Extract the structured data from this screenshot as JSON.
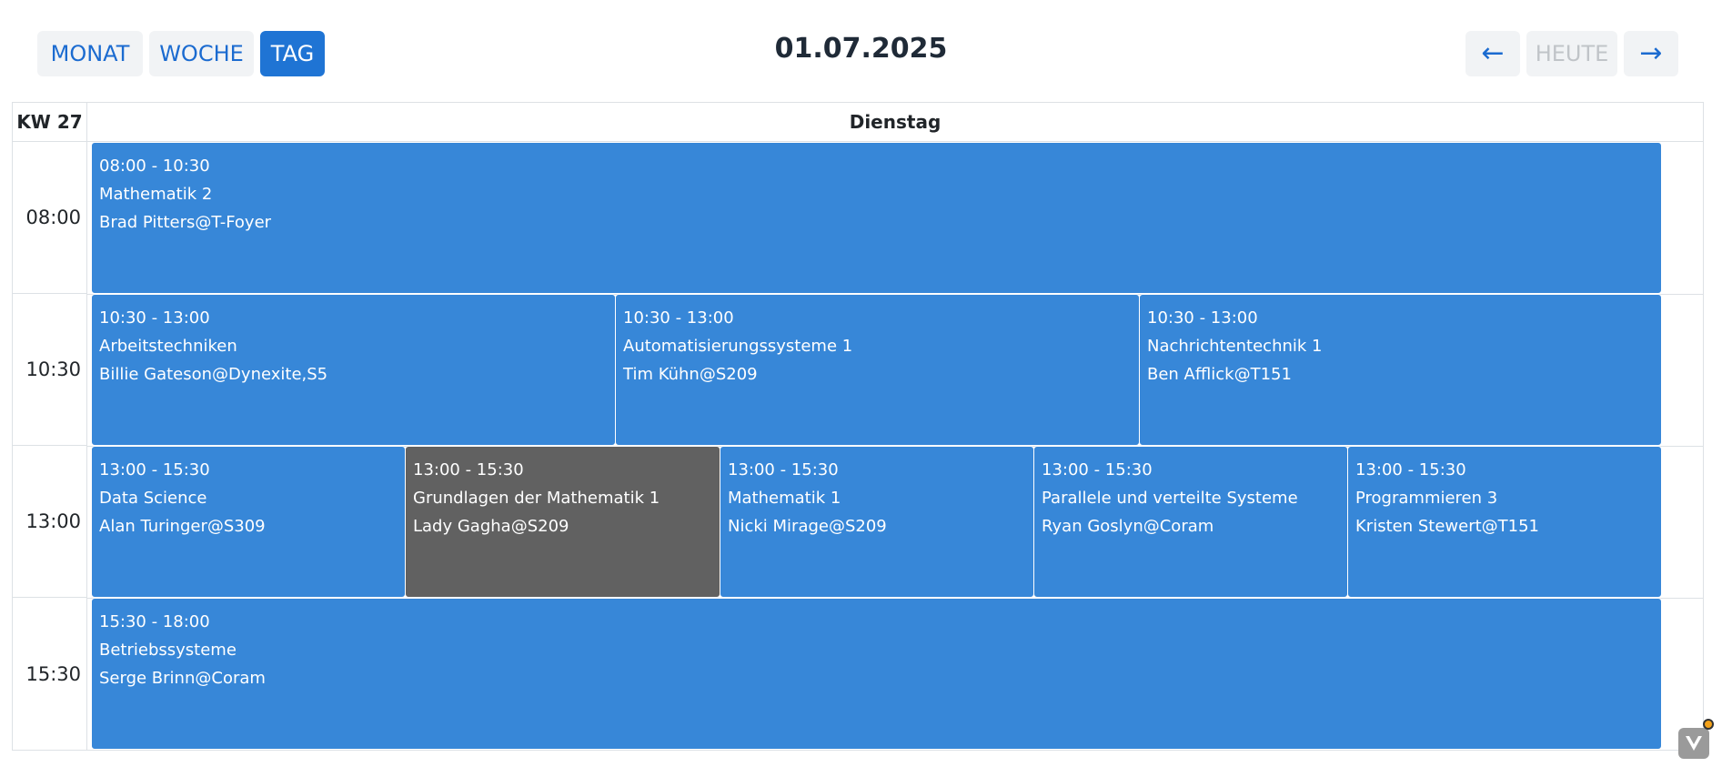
{
  "toolbar": {
    "view_month": "MONAT",
    "view_week": "WOCHE",
    "view_day": "TAG",
    "active_view": "TAG",
    "prev_arrow": "←",
    "today": "HEUTE",
    "next_arrow": "→",
    "date": "01.07.2025"
  },
  "calendar": {
    "week_label": "KW 27",
    "day_name": "Dienstag",
    "time_slots": [
      "08:00",
      "10:30",
      "13:00",
      "15:30"
    ],
    "events": [
      {
        "time": "08:00 - 10:30",
        "title": "Mathematik 2",
        "location": "Brad Pitters@T-Foyer",
        "color": "#3787d8"
      },
      {
        "time": "10:30 - 13:00",
        "title": "Arbeitstechniken",
        "location": "Billie Gateson@Dynexite,S5",
        "color": "#3787d8"
      },
      {
        "time": "10:30 - 13:00",
        "title": "Automatisierungssysteme 1",
        "location": "Tim Kühn@S209",
        "color": "#3787d8"
      },
      {
        "time": "10:30 - 13:00",
        "title": "Nachrichtentechnik 1",
        "location": "Ben Afflick@T151",
        "color": "#3787d8"
      },
      {
        "time": "13:00 - 15:30",
        "title": "Data Science",
        "location": "Alan Turinger@S309",
        "color": "#3787d8"
      },
      {
        "time": "13:00 - 15:30",
        "title": "Grundlagen der Mathematik 1",
        "location": "Lady Gagha@S209",
        "color": "#616161"
      },
      {
        "time": "13:00 - 15:30",
        "title": "Mathematik 1",
        "location": "Nicki Mirage@S209",
        "color": "#3787d8"
      },
      {
        "time": "13:00 - 15:30",
        "title": "Parallele und verteilte Systeme",
        "location": "Ryan Goslyn@Coram",
        "color": "#3787d8"
      },
      {
        "time": "13:00 - 15:30",
        "title": "Programmieren 3",
        "location": "Kristen Stewert@T151",
        "color": "#3787d8"
      },
      {
        "time": "15:30 - 18:00",
        "title": "Betriebssysteme",
        "location": "Serge Brinn@Coram",
        "color": "#3787d8"
      }
    ]
  },
  "widget": {
    "icon": "vue-devtools-icon"
  }
}
